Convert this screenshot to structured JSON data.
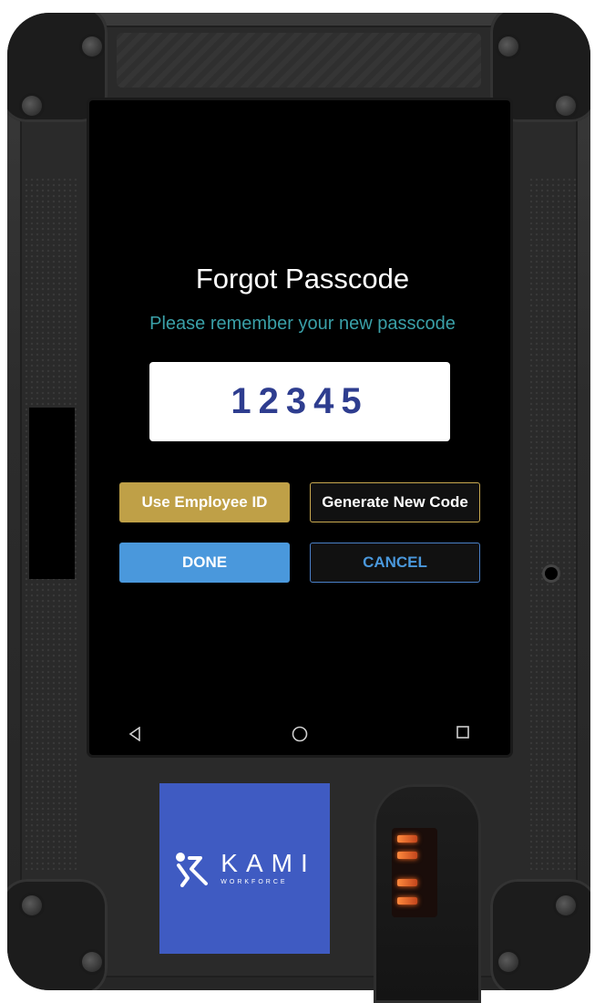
{
  "screen": {
    "title": "Forgot Passcode",
    "subtitle": "Please remember your new passcode",
    "passcode": "12345",
    "buttons": {
      "use_employee_id": "Use Employee ID",
      "generate_new_code": "Generate New Code",
      "done": "DONE",
      "cancel": "CANCEL"
    }
  },
  "nav_bar": {
    "back": "back-triangle-icon",
    "home": "home-circle-icon",
    "recents": "recents-square-icon"
  },
  "branding": {
    "logo_icon": "kami-k-icon",
    "name": "KAMI",
    "tagline": "WORKFORCE",
    "color": "#3f5bc2"
  },
  "colors": {
    "subtitle": "#3aa0a8",
    "passcode_text": "#2e3d8f",
    "gold": "#bfa047",
    "blue": "#4a98dc"
  }
}
